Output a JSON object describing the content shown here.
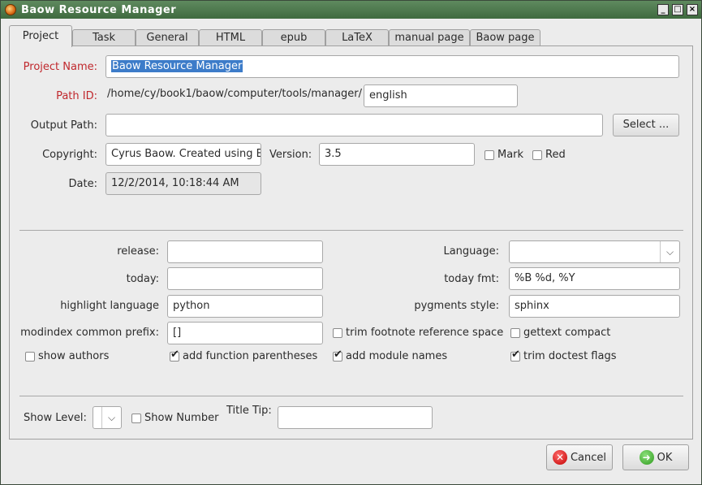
{
  "window": {
    "title": "Baow Resource Manager",
    "controls": [
      "_",
      "□",
      "×"
    ]
  },
  "tabs": [
    "Project",
    "Task",
    "General",
    "HTML",
    "epub",
    "LaTeX",
    "manual page",
    "Baow page"
  ],
  "project": {
    "name_label": "Project Name:",
    "name_value": "Baow Resource Manager",
    "path_id_label": "Path ID:",
    "path_prefix": "/home/cy/book1/baow/computer/tools/manager/",
    "path_id_value": "english",
    "output_label": "Output Path:",
    "output_value": "",
    "select_button": "Select ...",
    "copyright_label": "Copyright:",
    "copyright_value": "Cyrus Baow. Created using B",
    "version_label": "Version:",
    "version_value": "3.5",
    "mark_label": "Mark",
    "red_label": "Red",
    "date_label": "Date:",
    "date_value": "12/2/2014, 10:18:44 AM"
  },
  "sphinx": {
    "release_label": "release:",
    "release_value": "",
    "today_label": "today:",
    "today_value": "",
    "highlight_label": "highlight language",
    "highlight_value": "python",
    "modindex_label": "modindex common prefix:",
    "modindex_value": "[]",
    "language_label": "Language:",
    "language_value": "",
    "today_fmt_label": "today fmt:",
    "today_fmt_value": "%B %d, %Y",
    "pygments_label": "pygments style:",
    "pygments_value": "sphinx",
    "trim_footnote_label": "trim footnote reference space",
    "gettext_label": "gettext compact",
    "show_authors_label": "show authors",
    "add_function_label": "add function parentheses",
    "add_module_label": "add module names",
    "trim_doctest_label": "trim doctest flags"
  },
  "bottom": {
    "show_level_label": "Show Level:",
    "show_level_value": "",
    "show_number_label": "Show Number",
    "title_tip_label": "Title Tip:",
    "title_tip_value": ""
  },
  "footer": {
    "cancel_label": "Cancel",
    "ok_label": "OK"
  },
  "checks": {
    "mark": false,
    "red": false,
    "trim_footnote": false,
    "gettext": false,
    "show_authors": false,
    "add_function": true,
    "add_module": true,
    "trim_doctest": true,
    "show_number": false
  }
}
